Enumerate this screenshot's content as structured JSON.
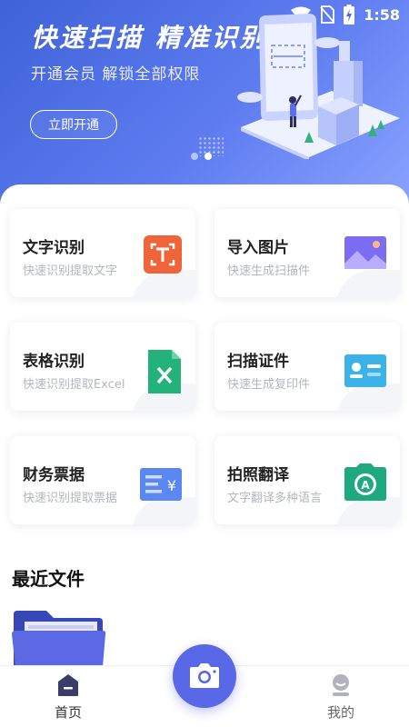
{
  "status_bar": {
    "time": "1:58",
    "icons": [
      "wifi-icon",
      "no-sim-icon",
      "battery-charging-icon"
    ]
  },
  "banner": {
    "title": "快速扫描  精准识别",
    "subtitle": "开通会员 解锁全部权限",
    "button_label": "立即开通",
    "page_indicator": {
      "count": 2,
      "active": 1
    }
  },
  "features": [
    {
      "title": "文字识别",
      "desc": "快速识别提取文字",
      "icon": "text-recognition-icon",
      "color": "#f0643a"
    },
    {
      "title": "导入图片",
      "desc": "快速生成扫描件",
      "icon": "image-import-icon",
      "color": "#7c6cf2"
    },
    {
      "title": "表格识别",
      "desc": "快速识别提取Excel",
      "icon": "excel-file-icon",
      "color": "#22b27a"
    },
    {
      "title": "扫描证件",
      "desc": "快速生成复印件",
      "icon": "id-card-icon",
      "color": "#3bb3e8"
    },
    {
      "title": "财务票据",
      "desc": "快速识别提取票据",
      "icon": "receipt-icon",
      "color": "#5b87f0"
    },
    {
      "title": "拍照翻译",
      "desc": "文字翻译多种语言",
      "icon": "camera-translate-icon",
      "color": "#1fa97f"
    }
  ],
  "recent": {
    "title": "最近文件"
  },
  "bottom_nav": {
    "home_label": "首页",
    "mine_label": "我的",
    "accent": "#5868e6"
  }
}
